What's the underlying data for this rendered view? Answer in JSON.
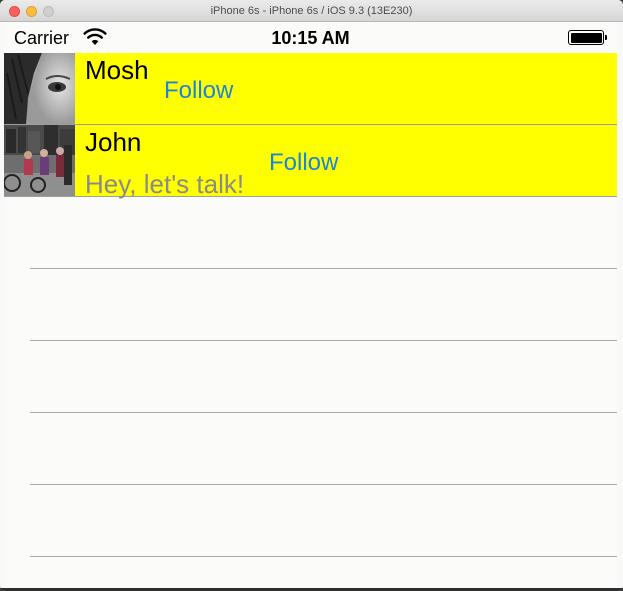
{
  "window": {
    "title": "iPhone 6s - iPhone 6s / iOS 9.3 (13E230)"
  },
  "statusbar": {
    "carrier": "Carrier",
    "time": "10:15 AM",
    "wifi_icon": "wifi-icon",
    "battery_icon": "battery-icon",
    "battery_level": 1.0
  },
  "table": {
    "rows": [
      {
        "name": "Mosh",
        "follow_label": "Follow",
        "message": "",
        "background": "#ffff00",
        "avatar": "avatar-photo-woman"
      },
      {
        "name": "John",
        "follow_label": "Follow",
        "message": "Hey, let's talk!",
        "background": "#ffff00",
        "avatar": "avatar-photo-street"
      }
    ],
    "empty_rows": 5
  },
  "colors": {
    "accent": "#1a86d9",
    "cell_background": "#ffff00",
    "secondary_text": "#8a8a8a"
  }
}
